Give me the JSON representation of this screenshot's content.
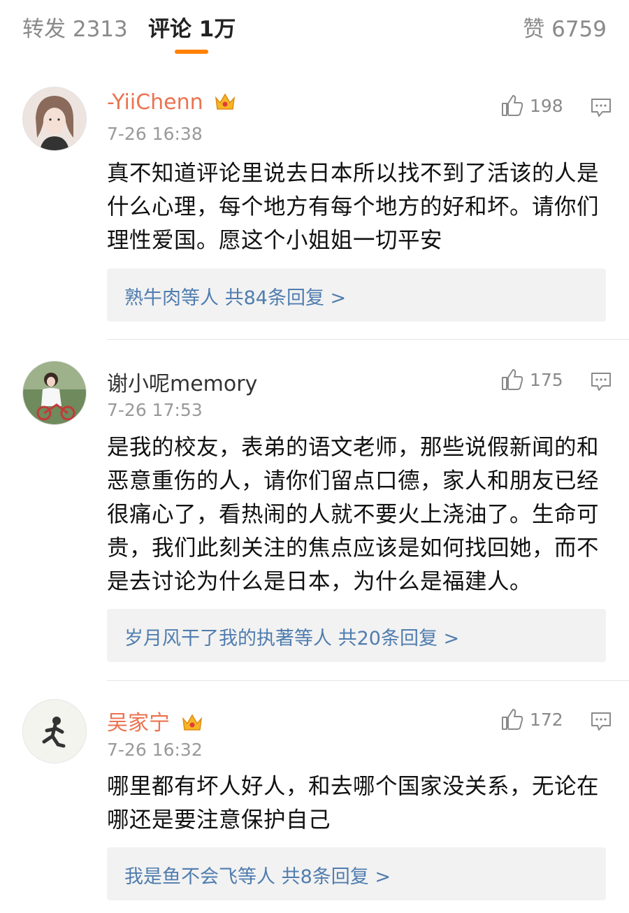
{
  "tabs": {
    "forward": "转发 2313",
    "comments": "评论 1万",
    "likes": "赞 6759"
  },
  "colors": {
    "accent": "#ff8200",
    "vip_name": "#eb7350",
    "link": "#507daf"
  },
  "comments": [
    {
      "username": "-YiiChenn",
      "vip": true,
      "time": "7-26 16:38",
      "likes": "198",
      "text": "真不知道评论里说去日本所以找不到了活该的人是什么心理，每个地方有每个地方的好和坏。请你们理性爱国。愿这个小姐姐一切平安",
      "replies": "熟牛肉等人  共84条回复 >"
    },
    {
      "username": "谢小呢memory",
      "vip": false,
      "time": "7-26 17:53",
      "likes": "175",
      "text": "是我的校友，表弟的语文老师，那些说假新闻的和恶意重伤的人，请你们留点口德，家人和朋友已经很痛心了，看热闹的人就不要火上浇油了。生命可贵，我们此刻关注的焦点应该是如何找回她，而不是去讨论为什么是日本，为什么是福建人。",
      "replies": "岁月风干了我的执著等人  共20条回复 >"
    },
    {
      "username": "吴家宁",
      "vip": true,
      "time": "7-26 16:32",
      "likes": "172",
      "text": "哪里都有坏人好人，和去哪个国家没关系，无论在哪还是要注意保护自己",
      "replies": "我是鱼不会飞等人  共8条回复 >"
    }
  ]
}
